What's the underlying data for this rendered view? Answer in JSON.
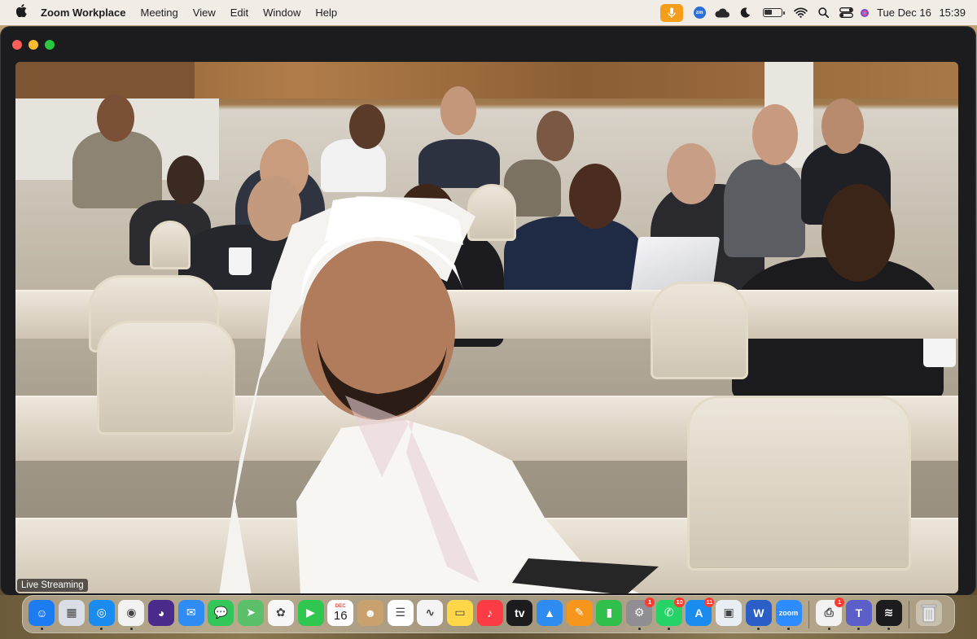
{
  "menubar": {
    "app_name": "Zoom Workplace",
    "menus": [
      "Meeting",
      "View",
      "Edit",
      "Window",
      "Help"
    ],
    "status_icons": [
      "microphone-icon",
      "zoom-status-icon",
      "cloud-icon",
      "moon-icon",
      "battery-icon",
      "wifi-icon",
      "search-icon",
      "control-center-icon",
      "siri-icon"
    ],
    "zoom_status_text": "zm",
    "date": "Tue Dec 16",
    "time": "15:39"
  },
  "window": {
    "live_label": "Live Streaming"
  },
  "dock": {
    "apps": [
      {
        "name": "Finder",
        "icon": "finder-icon",
        "bg": "#1e7cf2",
        "glyph": "☺",
        "running": true
      },
      {
        "name": "Launchpad",
        "icon": "launchpad-icon",
        "bg": "#d9dde6",
        "glyph": "▦",
        "running": false
      },
      {
        "name": "Safari",
        "icon": "safari-icon",
        "bg": "#1a8cf0",
        "glyph": "◎",
        "running": true
      },
      {
        "name": "Chrome",
        "icon": "chrome-icon",
        "bg": "#f2f2f2",
        "glyph": "◉",
        "running": true
      },
      {
        "name": "Firefox",
        "icon": "firefox-icon",
        "bg": "#4a2a8a",
        "glyph": "◕",
        "running": false
      },
      {
        "name": "Mail",
        "icon": "mail-icon",
        "bg": "#2f8cf5",
        "glyph": "✉",
        "running": false
      },
      {
        "name": "Messages",
        "icon": "messages-icon",
        "bg": "#33c759",
        "glyph": "💬",
        "running": false
      },
      {
        "name": "Maps",
        "icon": "maps-icon",
        "bg": "#5cbf6a",
        "glyph": "➤",
        "running": false
      },
      {
        "name": "Photos",
        "icon": "photos-icon",
        "bg": "#f7f7f7",
        "glyph": "✿",
        "running": false
      },
      {
        "name": "FaceTime",
        "icon": "facetime-icon",
        "bg": "#2fc750",
        "glyph": "▶",
        "running": false
      },
      {
        "name": "Calendar",
        "icon": "calendar-icon",
        "bg": "#ffffff",
        "glyph": "16",
        "month": "DEC",
        "running": false
      },
      {
        "name": "Contacts",
        "icon": "contacts-icon",
        "bg": "#c8a16e",
        "glyph": "☻",
        "running": false
      },
      {
        "name": "Reminders",
        "icon": "reminders-icon",
        "bg": "#ffffff",
        "glyph": "☰",
        "running": false
      },
      {
        "name": "Freeform",
        "icon": "freeform-icon",
        "bg": "#f4f4f4",
        "glyph": "∿",
        "running": false
      },
      {
        "name": "Notes",
        "icon": "notes-icon",
        "bg": "#ffd84a",
        "glyph": "▭",
        "running": false
      },
      {
        "name": "Music",
        "icon": "music-icon",
        "bg": "#fc3c44",
        "glyph": "♪",
        "running": false
      },
      {
        "name": "Apple TV",
        "icon": "apple-tv-icon",
        "bg": "#1c1c1e",
        "glyph": "tv",
        "running": false
      },
      {
        "name": "Keynote",
        "icon": "keynote-icon",
        "bg": "#2e8bf0",
        "glyph": "▲",
        "running": false
      },
      {
        "name": "Pages",
        "icon": "pages-icon",
        "bg": "#f7961d",
        "glyph": "✎",
        "running": false
      },
      {
        "name": "Numbers",
        "icon": "numbers-icon",
        "bg": "#2fbf4a",
        "glyph": "▮",
        "running": false
      },
      {
        "name": "System Settings",
        "icon": "settings-icon",
        "bg": "#8e8e93",
        "glyph": "⚙",
        "badge": "1",
        "running": true
      },
      {
        "name": "WhatsApp",
        "icon": "whatsapp-icon",
        "bg": "#25d366",
        "glyph": "✆",
        "badge": "10",
        "running": true
      },
      {
        "name": "App Store",
        "icon": "app-store-icon",
        "bg": "#1a8cf0",
        "glyph": "A",
        "badge": "11",
        "running": false
      },
      {
        "name": "Preview",
        "icon": "preview-icon",
        "bg": "#e9eef5",
        "glyph": "▣",
        "running": false
      },
      {
        "name": "Microsoft Word",
        "icon": "word-icon",
        "bg": "#2b5fc7",
        "glyph": "W",
        "running": true
      },
      {
        "name": "Zoom",
        "icon": "zoom-icon",
        "bg": "#2d8cff",
        "glyph": "zoom",
        "running": true
      }
    ],
    "recent_apps": [
      {
        "name": "Printer",
        "icon": "printer-icon",
        "bg": "#f2f2f2",
        "glyph": "⎙",
        "badge": "1",
        "running": true
      },
      {
        "name": "Teams",
        "icon": "teams-icon",
        "bg": "#5b5fc7",
        "glyph": "T",
        "running": true
      },
      {
        "name": "Voice Memos",
        "icon": "voice-memos-icon",
        "bg": "#1c1c1e",
        "glyph": "≋",
        "running": true
      }
    ],
    "trash": {
      "name": "Trash",
      "icon": "trash-icon",
      "glyph": "🗑"
    }
  }
}
